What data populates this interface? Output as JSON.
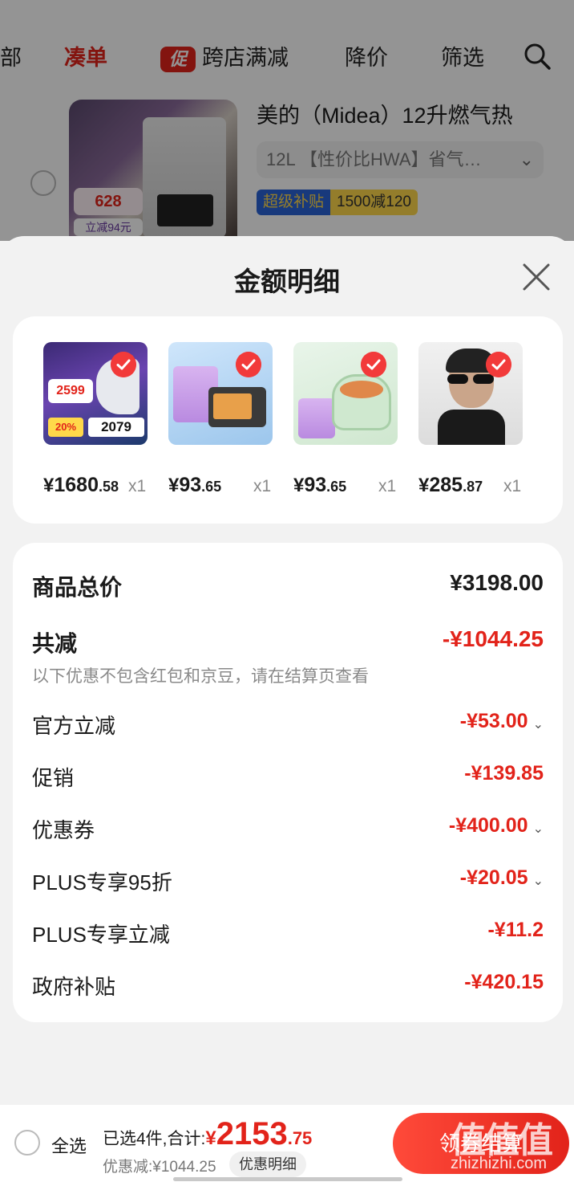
{
  "colors": {
    "accent_red": "#e2231a",
    "check_red": "#f23a3a",
    "tag_blue": "#2a63d6",
    "tag_yellow": "#ffd84a"
  },
  "background_page": {
    "nav": {
      "partial_left": "部",
      "active": "凑单",
      "promo_badge": "促",
      "cross_store": "跨店满减",
      "price_drop": "降价",
      "filter": "筛选",
      "search_icon": "search-icon"
    },
    "item": {
      "title": "美的（Midea）12升燃气热",
      "spec": "12L 【性价比HWA】省气…",
      "tag_primary": "超级补贴",
      "tag_secondary": "1500减120",
      "thumb_price": "628",
      "thumb_save": "立减94元"
    }
  },
  "sheet": {
    "title": "金额明细",
    "close_icon": "close-icon",
    "products": [
      {
        "price_int": "1680",
        "price_dec": ".58",
        "qty": "x1",
        "image": "water-heater-image"
      },
      {
        "price_int": "93",
        "price_dec": ".65",
        "qty": "x1",
        "image": "toaster-oven-image"
      },
      {
        "price_int": "93",
        "price_dec": ".65",
        "qty": "x1",
        "image": "electric-pot-image"
      },
      {
        "price_int": "285",
        "price_dec": ".87",
        "qty": "x1",
        "image": "sunglasses-image"
      }
    ],
    "currency": "¥",
    "summary": {
      "total_label": "商品总价",
      "total_value": "¥3198.00",
      "reduce_label": "共减",
      "reduce_value": "-¥1044.25",
      "note": "以下优惠不包含红包和京豆，请在结算页查看",
      "lines": [
        {
          "label": "官方立减",
          "value": "-¥53.00",
          "expandable": true
        },
        {
          "label": "促销",
          "value": "-¥139.85",
          "expandable": false
        },
        {
          "label": "优惠券",
          "value": "-¥400.00",
          "expandable": true
        },
        {
          "label": "PLUS专享95折",
          "value": "-¥20.05",
          "expandable": true
        },
        {
          "label": "PLUS专享立减",
          "value": "-¥11.2",
          "expandable": false
        },
        {
          "label": "政府补贴",
          "value": "-¥420.15",
          "expandable": false
        }
      ]
    }
  },
  "bottom_bar": {
    "select_all": "全选",
    "selected_text": "已选4件,合计:",
    "total_sym": "¥",
    "total_int": "2153",
    "total_dec": ".75",
    "discount_text": "优惠减:¥1044.25",
    "detail_button": "优惠明细",
    "checkout_button": "领券结算",
    "watermark_big": "值值值",
    "watermark_small": "zhizhizhi.com"
  }
}
